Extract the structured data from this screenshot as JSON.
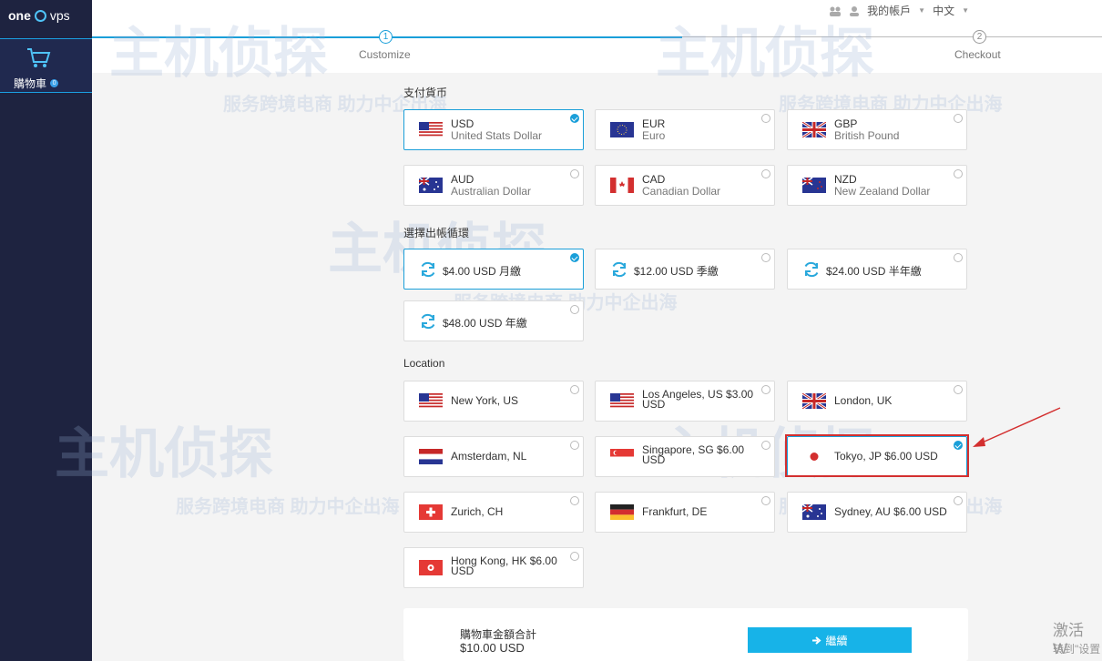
{
  "brand": {
    "logo_one": "one",
    "logo_vps": "vps"
  },
  "sidebar": {
    "cart_label": "購物車",
    "cart_badge": "0"
  },
  "topnav": {
    "account": "我的帳戶",
    "language": "中文"
  },
  "steps": [
    {
      "number": "1",
      "label": "Customize"
    },
    {
      "number": "2",
      "label": "Checkout"
    }
  ],
  "currency": {
    "title": "支付貨币",
    "options": [
      {
        "code": "USD",
        "name": "United Stats Dollar",
        "selected": true
      },
      {
        "code": "EUR",
        "name": "Euro",
        "selected": false
      },
      {
        "code": "GBP",
        "name": "British Pound",
        "selected": false
      },
      {
        "code": "AUD",
        "name": "Australian Dollar",
        "selected": false
      },
      {
        "code": "CAD",
        "name": "Canadian Dollar",
        "selected": false
      },
      {
        "code": "NZD",
        "name": "New Zealand Dollar",
        "selected": false
      }
    ]
  },
  "billing": {
    "title": "選擇出帳循環",
    "options": [
      {
        "label": "$4.00 USD 月繳",
        "selected": true
      },
      {
        "label": "$12.00 USD 季繳",
        "selected": false
      },
      {
        "label": "$24.00 USD 半年繳",
        "selected": false
      },
      {
        "label": "$48.00 USD 年繳",
        "selected": false
      }
    ]
  },
  "location": {
    "title": "Location",
    "options": [
      {
        "label": "New York, US",
        "flag": "us",
        "selected": false
      },
      {
        "label": "Los Angeles, US $3.00 USD",
        "flag": "us",
        "selected": false
      },
      {
        "label": "London, UK",
        "flag": "uk",
        "selected": false
      },
      {
        "label": "Amsterdam, NL",
        "flag": "nl",
        "selected": false
      },
      {
        "label": "Singapore, SG $6.00 USD",
        "flag": "sg",
        "selected": false
      },
      {
        "label": "Tokyo, JP $6.00 USD",
        "flag": "jp",
        "selected": true
      },
      {
        "label": "Zurich, CH",
        "flag": "ch",
        "selected": false
      },
      {
        "label": "Frankfurt, DE",
        "flag": "de",
        "selected": false
      },
      {
        "label": "Sydney, AU $6.00 USD",
        "flag": "au",
        "selected": false
      },
      {
        "label": "Hong Kong, HK $6.00 USD",
        "flag": "hk",
        "selected": false
      }
    ]
  },
  "summary": {
    "label": "購物車金額合計",
    "total": "$10.00 USD",
    "continue_label": "繼續"
  },
  "watermark": {
    "brand": "主机侦探",
    "slogan": "服务跨境电商 助力中企出海"
  },
  "os_notice": {
    "line1": "激活 W",
    "line2": "转到\"设置"
  },
  "colors": {
    "accent": "#1a9fd9",
    "sidebar": "#1e2340",
    "button": "#17b3e8",
    "highlight": "#d32f2f"
  }
}
